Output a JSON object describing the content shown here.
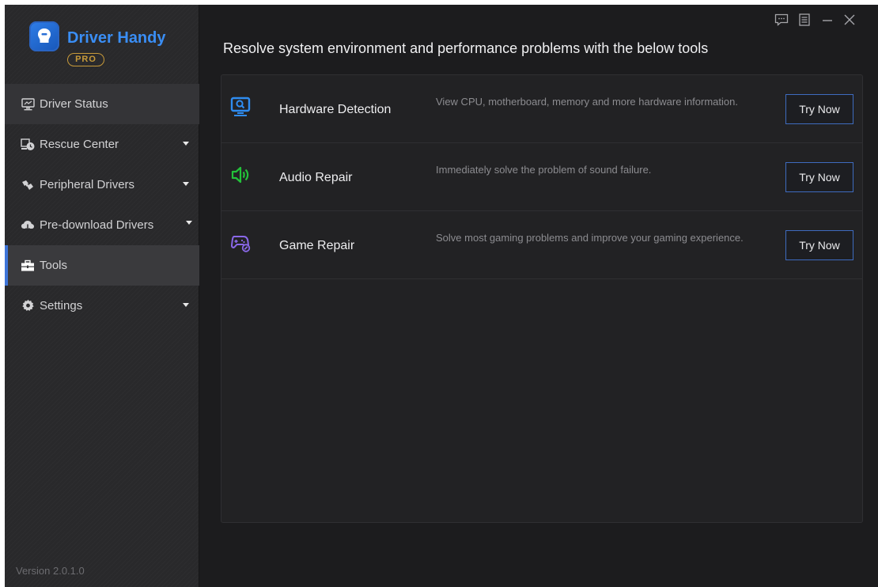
{
  "app": {
    "name": "Driver Handy",
    "edition": "PRO",
    "version": "Version 2.0.1.0",
    "accent_color": "#3d74d8",
    "brand_color": "#3a8ef5"
  },
  "window_controls": {
    "feedback_icon": "chat-icon",
    "menu_icon": "list-icon",
    "minimize_icon": "minimize-icon",
    "close_icon": "close-icon"
  },
  "sidebar": {
    "items": [
      {
        "label": "Driver Status",
        "icon": "monitor-icon",
        "has_dropdown": false
      },
      {
        "label": "Rescue Center",
        "icon": "backup-clock-icon",
        "has_dropdown": true
      },
      {
        "label": "Peripheral Drivers",
        "icon": "peripheral-icon",
        "has_dropdown": true
      },
      {
        "label": "Pre-download Drivers",
        "icon": "cloud-download-icon",
        "has_dropdown": true
      },
      {
        "label": "Tools",
        "icon": "toolbox-icon",
        "has_dropdown": false,
        "active": true
      },
      {
        "label": "Settings",
        "icon": "gear-icon",
        "has_dropdown": true
      }
    ]
  },
  "main": {
    "headline": "Resolve system environment and performance problems with the below tools",
    "tools": [
      {
        "name": "Hardware Detection",
        "description": "View CPU, motherboard, memory and more hardware information.",
        "button": "Try Now",
        "icon": "hardware-scan-icon",
        "icon_color": "#2f8cf0"
      },
      {
        "name": "Audio Repair",
        "description": "Immediately solve the problem of sound failure.",
        "button": "Try Now",
        "icon": "speaker-icon",
        "icon_color": "#23c23a"
      },
      {
        "name": "Game Repair",
        "description": "Solve most gaming problems and improve your gaming experience.",
        "button": "Try Now",
        "icon": "gamepad-icon",
        "icon_color": "#8a68e8"
      }
    ]
  }
}
